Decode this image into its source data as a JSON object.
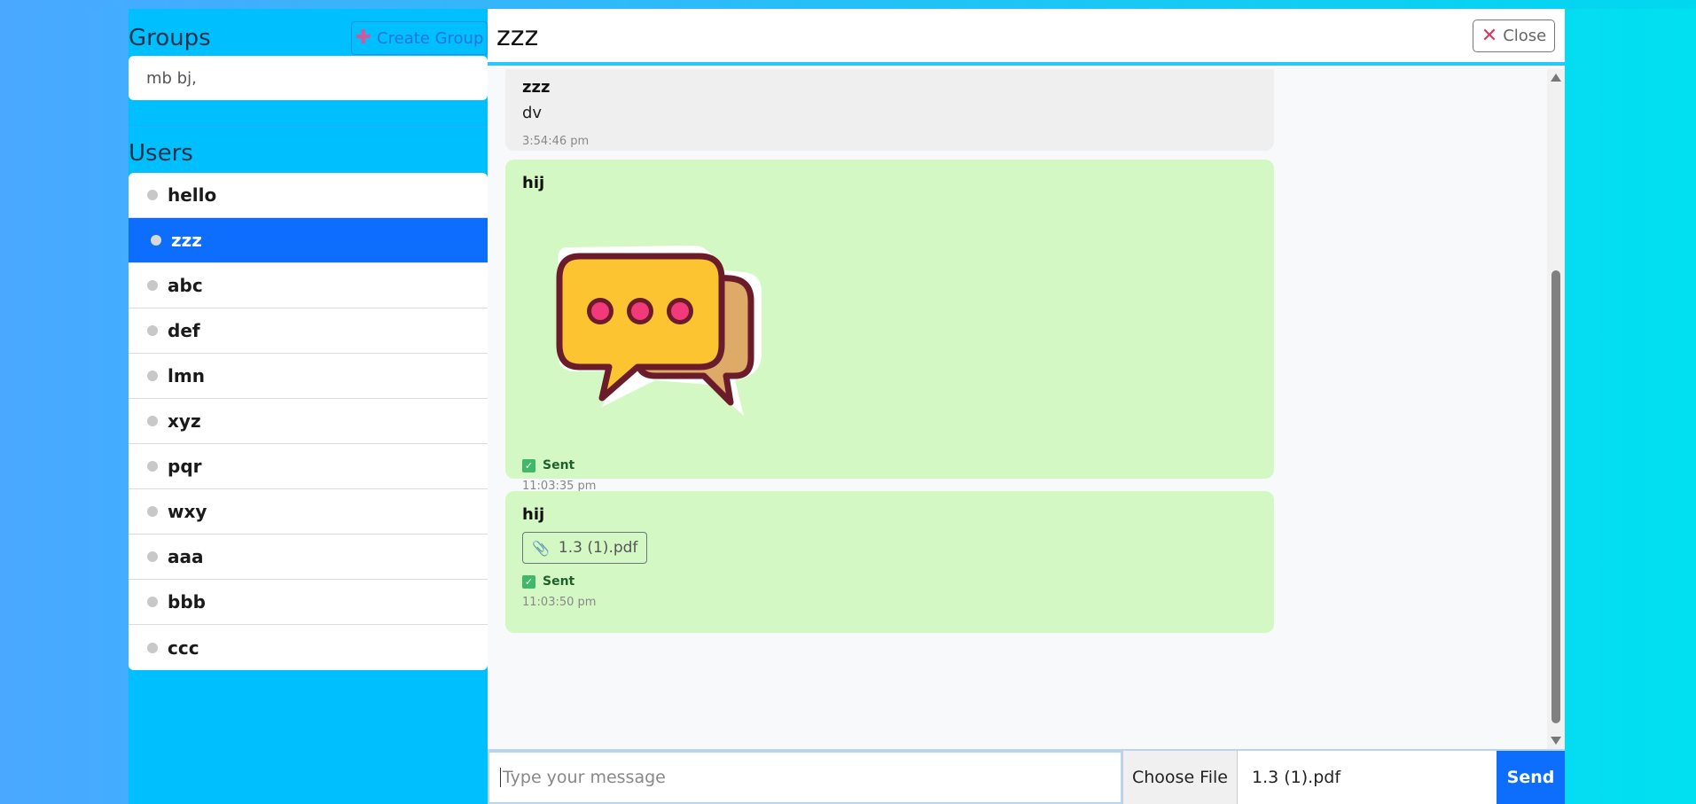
{
  "sidebar": {
    "groups_title": "Groups",
    "create_group_label": "Create Group",
    "groups": [
      "mb bj,"
    ],
    "users_title": "Users",
    "users": [
      {
        "name": "hello",
        "active": false
      },
      {
        "name": "zzz",
        "active": true
      },
      {
        "name": "abc",
        "active": false
      },
      {
        "name": "def",
        "active": false
      },
      {
        "name": "lmn",
        "active": false
      },
      {
        "name": "xyz",
        "active": false
      },
      {
        "name": "pqr",
        "active": false
      },
      {
        "name": "wxy",
        "active": false
      },
      {
        "name": "aaa",
        "active": false
      },
      {
        "name": "bbb",
        "active": false
      },
      {
        "name": "ccc",
        "active": false
      }
    ]
  },
  "chat": {
    "title": "zzz",
    "close_label": "Close",
    "messages": [
      {
        "sender": "zzz",
        "text": "dv",
        "time": "3:54:46 pm",
        "type": "received"
      },
      {
        "sender": "hij",
        "attachment": "sticker",
        "status": "Sent",
        "time": "11:03:35 pm",
        "type": "sent"
      },
      {
        "sender": "hij",
        "file": "1.3 (1).pdf",
        "status": "Sent",
        "time": "11:03:50 pm",
        "type": "sent"
      }
    ],
    "composer": {
      "placeholder": "Type your message",
      "choose_file_label": "Choose File",
      "selected_file": "1.3 (1).pdf",
      "send_label": "Send"
    }
  }
}
